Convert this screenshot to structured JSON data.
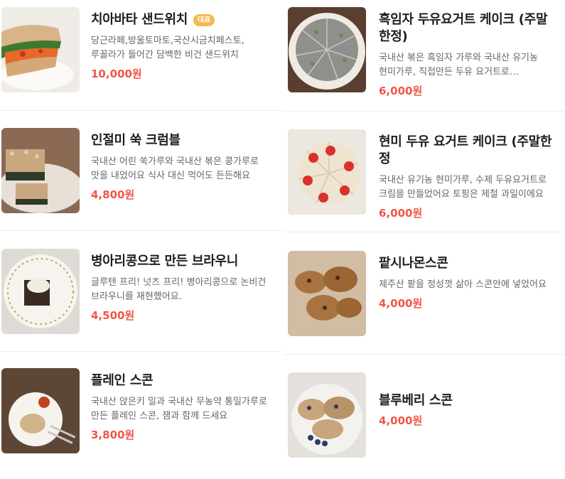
{
  "menu": {
    "left": [
      {
        "name": "치아바타 샌드위치",
        "badge": "대표",
        "description": "당근라페,방울토마토,국산시금치페스토,루꼴라가 들어간 담백한 비건 샌드위치",
        "price": "10,000원",
        "image": "sandwich-photo"
      },
      {
        "name": "인절미 쑥 크럼블",
        "description": "국내산 어린 쑥가루와 국내산 볶은 콩가루로 맛을 내었어요 식사 대신 먹어도 든든해요",
        "price": "4,800원",
        "image": "crumble-photo"
      },
      {
        "name": "병아리콩으로 만든 브라우니",
        "description": "글루텐 프리! 넛츠 프리! 병아리콩으로 논비건 브라우니를 재현했어요.",
        "price": "4,500원",
        "image": "brownie-photo"
      },
      {
        "name": "플레인 스콘",
        "description": "국내산 앉은키 밀과 국내산 무농약 통밀가루로 만든 플레인 스콘, 잼과 함께 드세요",
        "price": "3,800원",
        "image": "plain-scone-photo"
      }
    ],
    "right": [
      {
        "name": "흑임자 두유요거트 케이크 (주말한정)",
        "description": "국내산 볶은 흑임자 가루와 국내산 유기농 현미가루, 직접만든 두유 요거트로 만들었어요",
        "price": "6,000원",
        "image": "black-sesame-cake-photo"
      },
      {
        "name": "현미 두유 요거트 케이크 (주말한정",
        "description": "국내산 유기농 현미가루, 수제 두유요거트로 크림을 만들었어요 토핑은 제철 과일이에요",
        "price": "6,000원",
        "image": "strawberry-cake-photo"
      },
      {
        "name": "팥시나몬스콘",
        "description": "제주산 팥을 정성껏 삶아 스콘안에 넣었어요",
        "price": "4,000원",
        "image": "red-bean-scone-photo"
      },
      {
        "name": "블루베리 스콘",
        "description": "",
        "price": "4,000원",
        "image": "blueberry-scone-photo"
      }
    ]
  },
  "colors": {
    "price": "#f25548",
    "badge": "#f8b84b",
    "divider": "#ececec"
  }
}
